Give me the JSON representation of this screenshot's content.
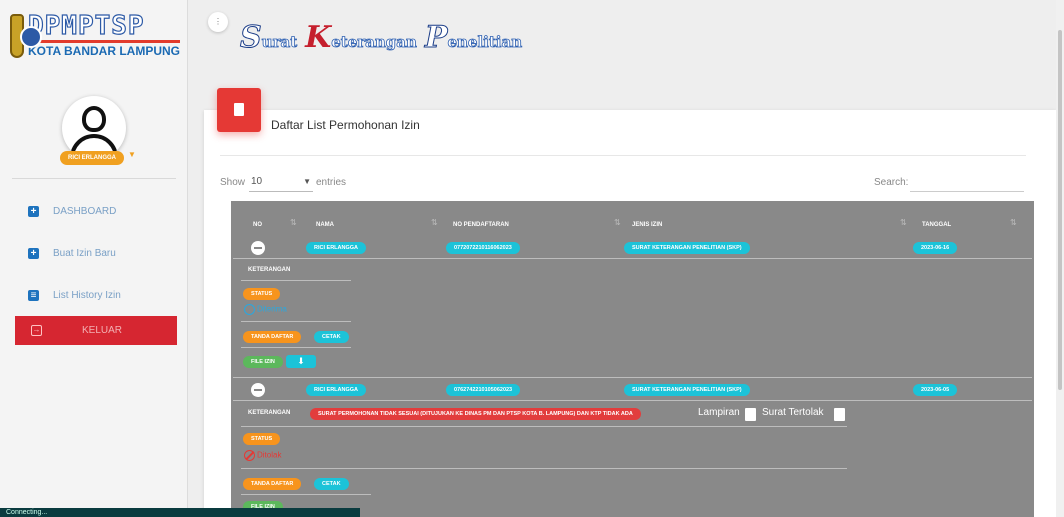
{
  "logo": {
    "main": "DPMPTSP",
    "sub": "KOTA BANDAR LAMPUNG"
  },
  "topbar": {
    "title_caps": [
      "S",
      "K",
      "P"
    ],
    "title_rest": [
      "urat",
      "eterangan",
      "enelitian"
    ]
  },
  "user": {
    "name": "RICI ERLANGGA"
  },
  "sidebar": {
    "items": [
      {
        "label": "DASHBOARD",
        "icon": "plus-square-icon"
      },
      {
        "label": "Buat Izin Baru",
        "icon": "plus-square-icon"
      },
      {
        "label": "List History Izin",
        "icon": "list-icon"
      }
    ],
    "logout": {
      "label": "KELUAR",
      "icon": "logout-icon"
    }
  },
  "card": {
    "title": "Daftar List Permohonan Izin"
  },
  "table_controls": {
    "show_label": "Show",
    "entries_value": "10",
    "entries_label": "entries",
    "search_label": "Search:",
    "search_value": ""
  },
  "table": {
    "headers": [
      "NO",
      "NAMA",
      "NO PENDAFTARAN",
      "JENIS IZIN",
      "TANGGAL"
    ],
    "rows": [
      {
        "nama": "RICI ERLANGGA",
        "no_pendaftaran": "0772072210116062023",
        "jenis_izin": "SURAT KETERANGAN PENELITIAN (SKP)",
        "tanggal": "2023-06-16",
        "keterangan_label": "KETERANGAN",
        "status_label": "STATUS",
        "status_text": "Diterima",
        "tanda_daftar": "TANDA DAFTAR",
        "cetak": "CETAK",
        "file_izin": "FILE IZIN",
        "download_icon": "download-icon"
      },
      {
        "nama": "RICI ERLANGGA",
        "no_pendaftaran": "0762742210105062023",
        "jenis_izin": "SURAT KETERANGAN PENELITIAN (SKP)",
        "tanggal": "2023-06-05",
        "keterangan_label": "KETERANGAN",
        "keterangan": "SURAT PERMOHONAN TIDAK SESUAI (DITUJUKAN KE DINAS PM DAN PTSP KOTA B. LAMPUNG) DAN KTP TIDAK ADA",
        "lampiran_label": "Lampiran",
        "surat_tertolak_label": "Surat Tertolak",
        "status_label": "STATUS",
        "status_text": "Ditolak",
        "tanda_daftar": "TANDA DAFTAR",
        "cetak": "CETAK",
        "file_izin": "FILE IZIN"
      }
    ]
  },
  "statusbar": {
    "text": "Connecting..."
  },
  "colors": {
    "accent_red": "#e53935",
    "cyan": "#1cc3d8",
    "orange": "#f7941d",
    "green": "#5cb85c",
    "blue": "#1e73be"
  }
}
